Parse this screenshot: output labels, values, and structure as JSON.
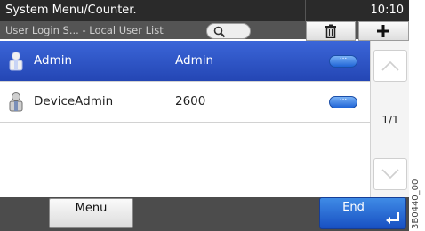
{
  "header": {
    "title": "System Menu/Counter.",
    "time": "10:10"
  },
  "subheader": {
    "breadcrumb": "User Login S... - Local User List"
  },
  "toolbar": {
    "search_icon": "search-icon",
    "delete_icon": "trash-icon",
    "add_icon": "plus-icon"
  },
  "users": [
    {
      "name": "Admin",
      "value": "Admin",
      "selected": true,
      "detail_label": "..."
    },
    {
      "name": "DeviceAdmin",
      "value": "2600",
      "selected": false,
      "detail_label": "..."
    }
  ],
  "pagination": {
    "indicator": "1/1"
  },
  "footer": {
    "menu_label": "Menu",
    "end_label": "End"
  },
  "side_code": "3B0440_00",
  "colors": {
    "selected_row": "#2f58c8",
    "primary_button": "#1f64d6",
    "title_bar": "#2a2a2a"
  }
}
